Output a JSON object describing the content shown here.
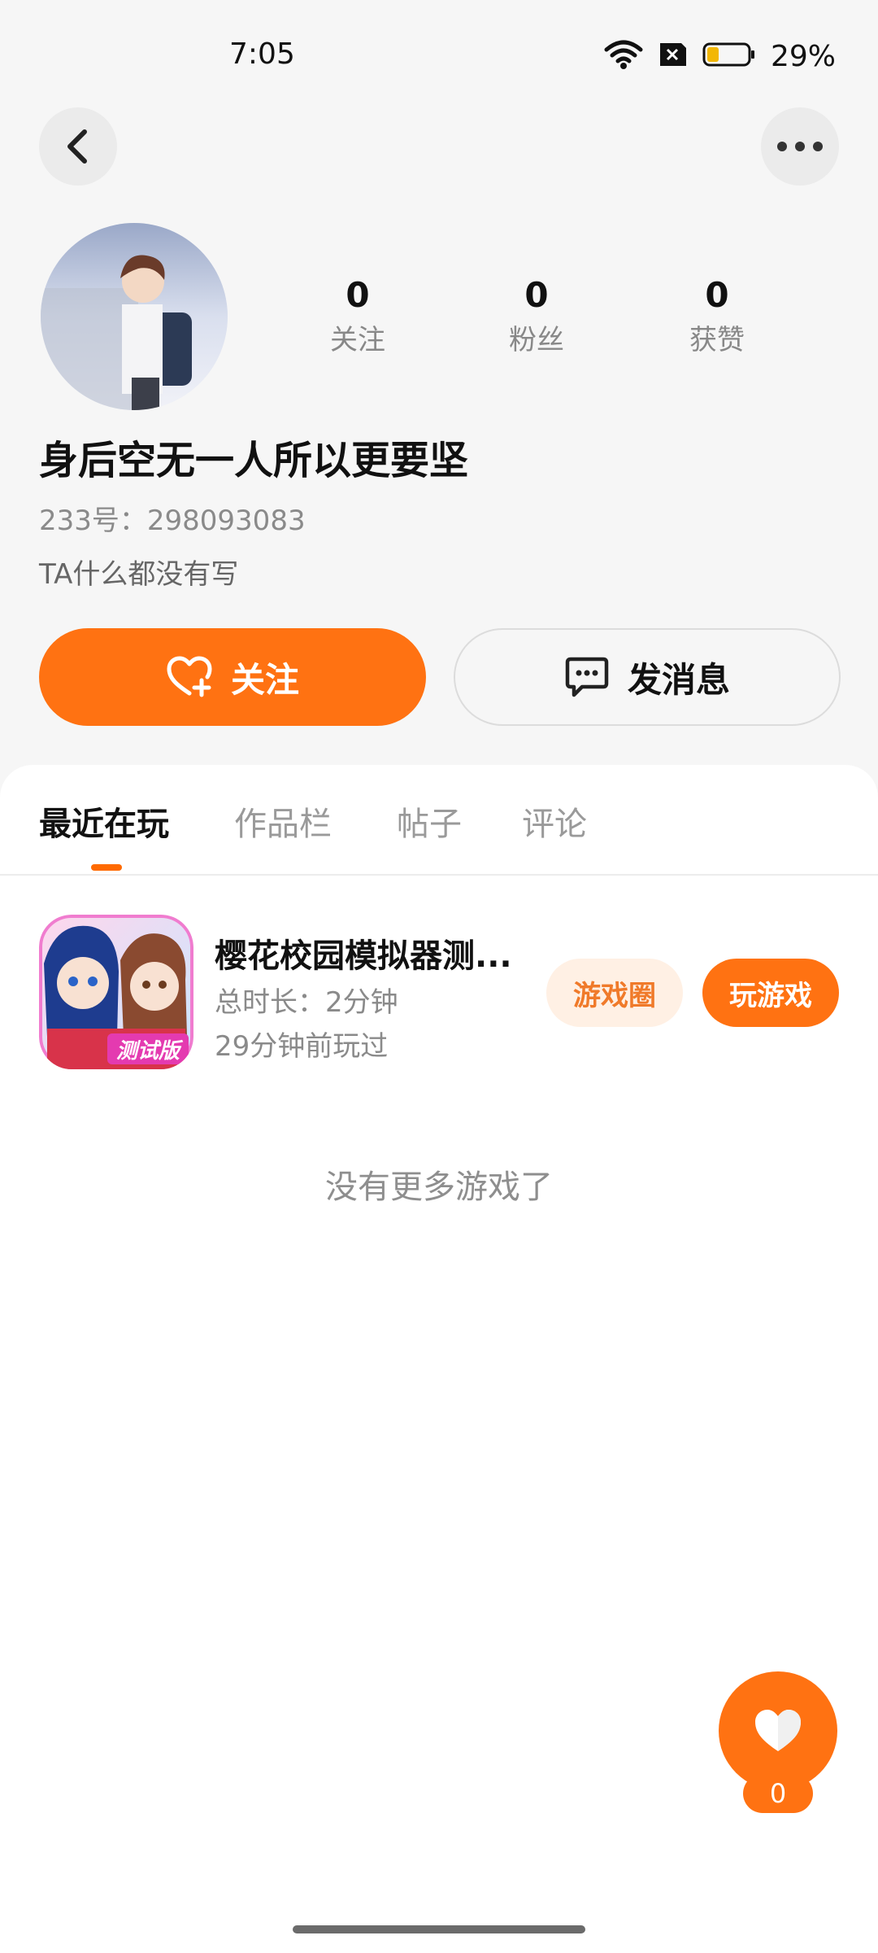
{
  "status": {
    "time": "7:05",
    "battery_pct": "29%",
    "battery_level": 0.29
  },
  "header": {
    "back_icon": "chevron-left-icon",
    "more_icon": "more-dots-icon"
  },
  "profile": {
    "stats": [
      {
        "value": "0",
        "label": "关注"
      },
      {
        "value": "0",
        "label": "粉丝"
      },
      {
        "value": "0",
        "label": "获赞"
      }
    ],
    "name": "身后空无一人所以更要坚",
    "id_text": "233号：298093083",
    "bio": "TA什么都没有写"
  },
  "actions": {
    "follow_label": "关注",
    "message_label": "发消息"
  },
  "tabs": [
    {
      "label": "最近在玩",
      "active": true
    },
    {
      "label": "作品栏",
      "active": false
    },
    {
      "label": "帖子",
      "active": false
    },
    {
      "label": "评论",
      "active": false
    }
  ],
  "game": {
    "title": "樱花校园模拟器测...",
    "duration": "总时长：2分钟",
    "last_played": "29分钟前玩过",
    "badge": "测试版",
    "circle_label": "游戏圈",
    "play_label": "玩游戏"
  },
  "empty_text": "没有更多游戏了",
  "like_count": "0",
  "colors": {
    "accent": "#ff7212",
    "pill_bg": "#fff0e4"
  }
}
